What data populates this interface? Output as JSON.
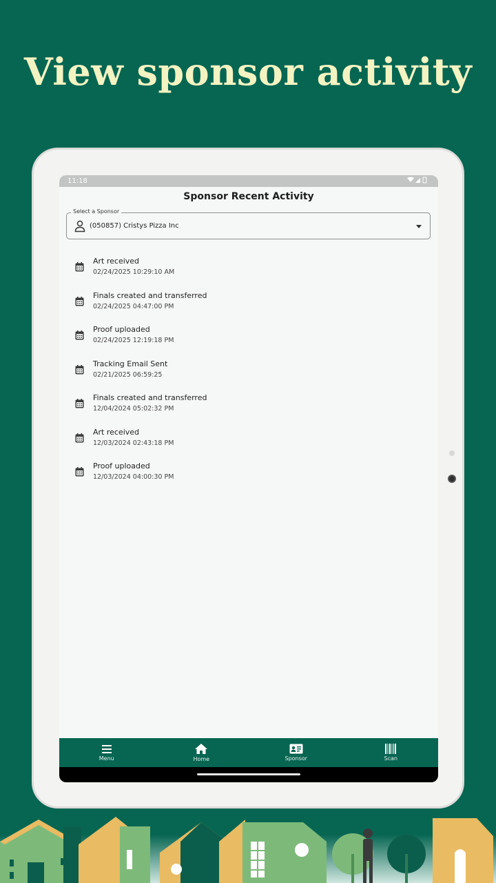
{
  "headline": "View sponsor activity",
  "status_bar": {
    "time": "11:18"
  },
  "app": {
    "title": "Sponsor Recent Activity",
    "select": {
      "label": "Select a Sponsor",
      "value": "(050857) Cristys Pizza Inc"
    },
    "activities": [
      {
        "title": "Art received",
        "date": "02/24/2025 10:29:10 AM"
      },
      {
        "title": "Finals created and transferred",
        "date": "02/24/2025 04:47:00 PM"
      },
      {
        "title": "Proof uploaded",
        "date": "02/24/2025 12:19:18 PM"
      },
      {
        "title": "Tracking Email Sent",
        "date": "02/21/2025 06:59:25"
      },
      {
        "title": "Finals created and transferred",
        "date": "12/04/2024 05:02:32 PM"
      },
      {
        "title": "Art received",
        "date": "12/03/2024 02:43:18 PM"
      },
      {
        "title": "Proof uploaded",
        "date": "12/03/2024 04:00:30 PM"
      }
    ],
    "nav": [
      {
        "label": "Menu",
        "icon": "menu-icon"
      },
      {
        "label": "Home",
        "icon": "home-icon"
      },
      {
        "label": "Sponsor",
        "icon": "id-card-icon"
      },
      {
        "label": "Scan",
        "icon": "barcode-icon"
      }
    ]
  },
  "colors": {
    "background": "#076652",
    "headline": "#f4f3c2",
    "nav": "#076652"
  }
}
